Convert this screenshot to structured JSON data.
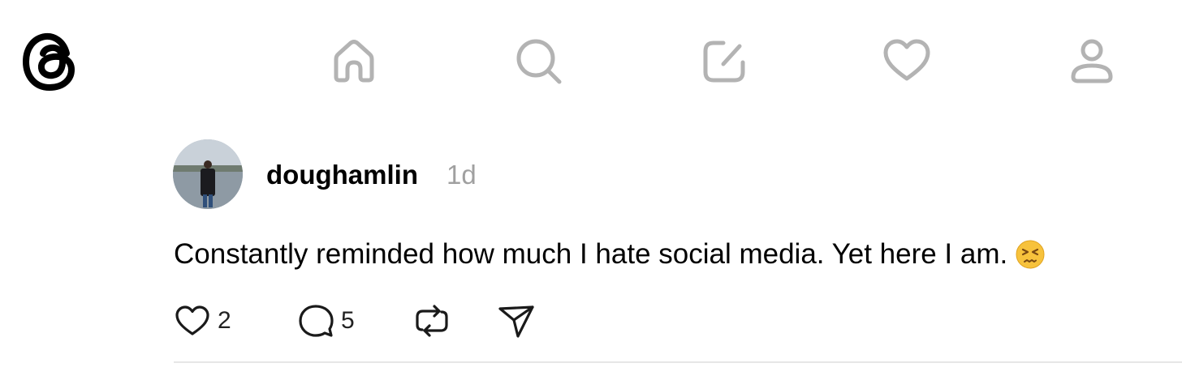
{
  "nav": {
    "logo_icon": "threads-logo-icon",
    "items": [
      {
        "icon": "home-icon"
      },
      {
        "icon": "search-icon"
      },
      {
        "icon": "compose-icon"
      },
      {
        "icon": "heart-icon"
      },
      {
        "icon": "profile-icon"
      }
    ],
    "inactive_color": "#b3b3b3"
  },
  "post": {
    "username": "doughamlin",
    "timestamp": "1d",
    "text": "Constantly reminded how much I hate social media. Yet here I am.",
    "emoji": "persevering-face",
    "actions": {
      "like_count": "2",
      "reply_count": "5",
      "repost_icon": "repost-icon",
      "share_icon": "send-icon"
    }
  }
}
